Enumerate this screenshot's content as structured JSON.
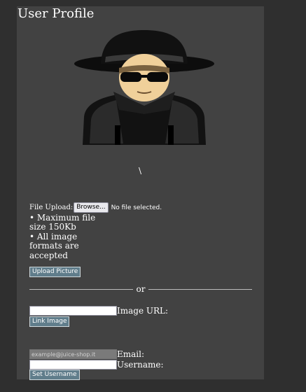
{
  "page": {
    "title": "User Profile",
    "backslash": "\\"
  },
  "avatar": {
    "icon": "incognito-avatar-icon"
  },
  "upload": {
    "label": "File Upload:",
    "browse_label": "Browse...",
    "no_file_text": "No file selected.",
    "hint_size": "• Maximum file size 150Kb",
    "hint_formats": "• All image formats are accepted",
    "button_label": "Upload Picture"
  },
  "divider": {
    "text": "or"
  },
  "image_url": {
    "label": "Image URL:",
    "value": "",
    "button_label": "Link Image"
  },
  "profile": {
    "email_label": "Email:",
    "email_placeholder": "example@juice-shop.it",
    "username_label": "Username:",
    "username_value": "",
    "button_label": "Set Username"
  },
  "colors": {
    "background": "#2f2f2f",
    "panel": "#424242",
    "button": "#607d8b"
  }
}
